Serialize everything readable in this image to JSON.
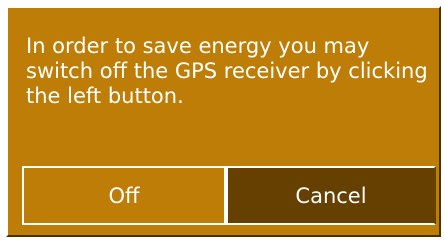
{
  "dialog": {
    "message": "In order to save energy you may\nswitch off the GPS receiver by clicking\nthe left button.",
    "buttons": {
      "off_label": "Off",
      "cancel_label": "Cancel"
    }
  },
  "colors": {
    "dialog_background": "#bd7d06",
    "cancel_button_background": "#664000",
    "text": "#ffffff"
  }
}
